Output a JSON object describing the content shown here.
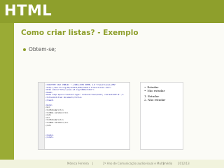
{
  "slide": {
    "title": "HTML",
    "subtitle": "Como criar listas? - Exemplo",
    "bullet": "Obtem-se;"
  },
  "code_screenshot": {
    "lines": [
      "<!DOCTYPE html PUBLIC \"-//W3C//DTD XHTML 1.0 Transitional//EN\"",
      "\"http://www.w3.org/TR/xhtml1/DTD/xhtml1-transitional.dtd\">",
      "<html xmlns=\"http://www.w3.org/1999/xhtml\">",
      "<head>",
      "<meta http-equiv=\"Content-Type\" content=\"text/html; charset=UTF-8\" />",
      "<title>Untitled Document</title>",
      "</head>",
      "",
      "<body>",
      "<ul>",
      "<li>Estudar</li>",
      "<li>Não estudar</li>",
      "</ul>",
      "<ol>",
      "<li>Estudar</li>",
      "<li>Não estudar</li>",
      "</ol>",
      "",
      "",
      "",
      "</body>",
      "</html>"
    ]
  },
  "rendered_output": {
    "unordered": [
      "Estudar",
      "Não estudar"
    ],
    "ordered": [
      "1. Estudar",
      "2. Não estudar"
    ]
  },
  "footer": {
    "author": "Mónica Ferreira",
    "sep1": "|",
    "course": "2º Ano de Comunicação audiovisual e Multimédia",
    "sep2": "|",
    "year": "2012/13"
  },
  "colors": {
    "accent": "#8e9f2c",
    "sidebar": "#9aab35",
    "footer_bg": "#f1f3dd"
  }
}
